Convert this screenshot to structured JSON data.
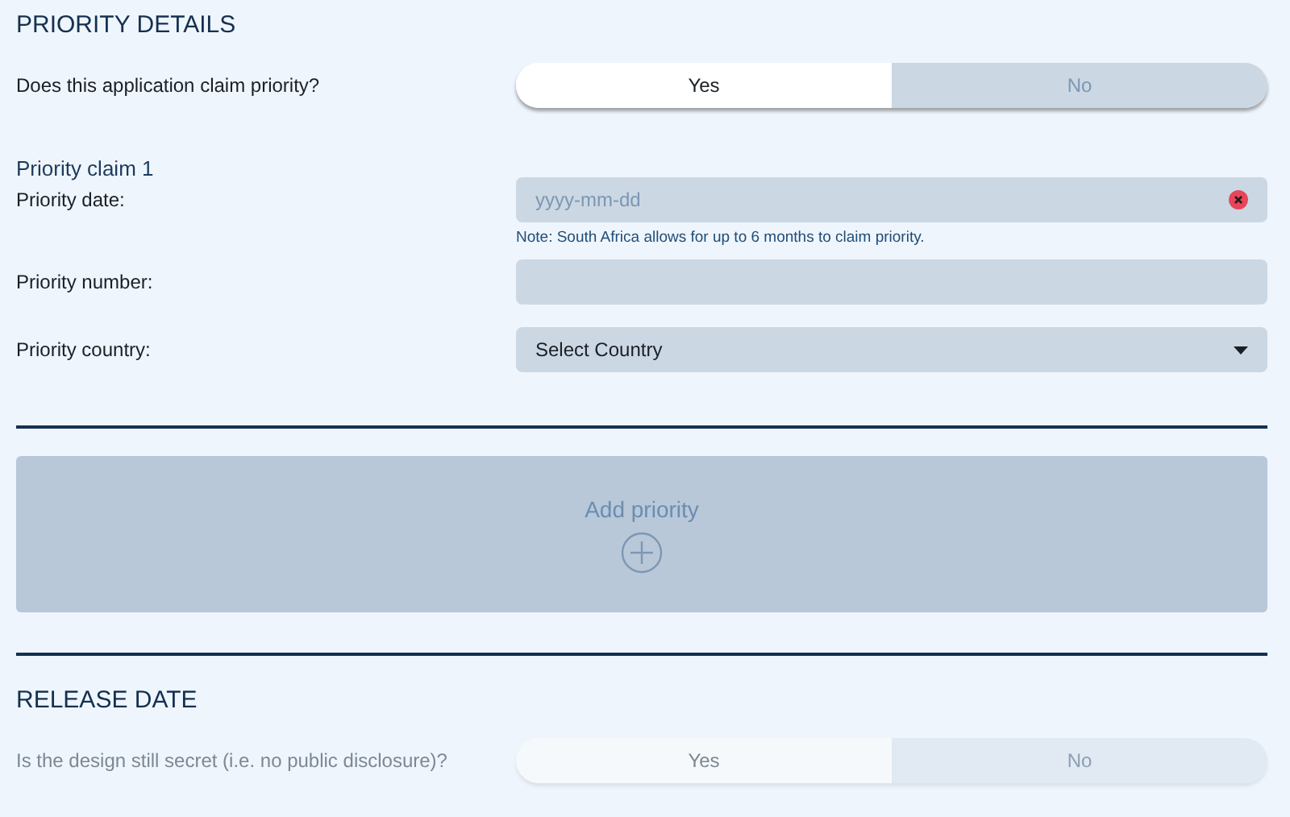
{
  "priority_details": {
    "heading": "PRIORITY DETAILS",
    "claim_question": {
      "label": "Does this application claim priority?",
      "disabled": false,
      "options": [
        {
          "label": "Yes",
          "selected": true
        },
        {
          "label": "No",
          "selected": false
        }
      ]
    },
    "claims": [
      {
        "title": "Priority claim 1",
        "fields": [
          {
            "kind": "date",
            "label": "Priority date:",
            "placeholder": "yyyy-mm-dd",
            "note": "Note: South Africa allows for up to 6 months to claim priority."
          },
          {
            "kind": "text",
            "label": "Priority number:"
          },
          {
            "kind": "select",
            "label": "Priority country:",
            "value": "Select Country"
          }
        ]
      }
    ],
    "add_button": {
      "label": "Add priority"
    }
  },
  "release_date": {
    "heading": "RELEASE DATE",
    "question": {
      "label": "Is the design still secret (i.e. no public disclosure)?",
      "disabled": true,
      "options": [
        {
          "label": "Yes",
          "selected": true
        },
        {
          "label": "No",
          "selected": false
        }
      ]
    }
  }
}
